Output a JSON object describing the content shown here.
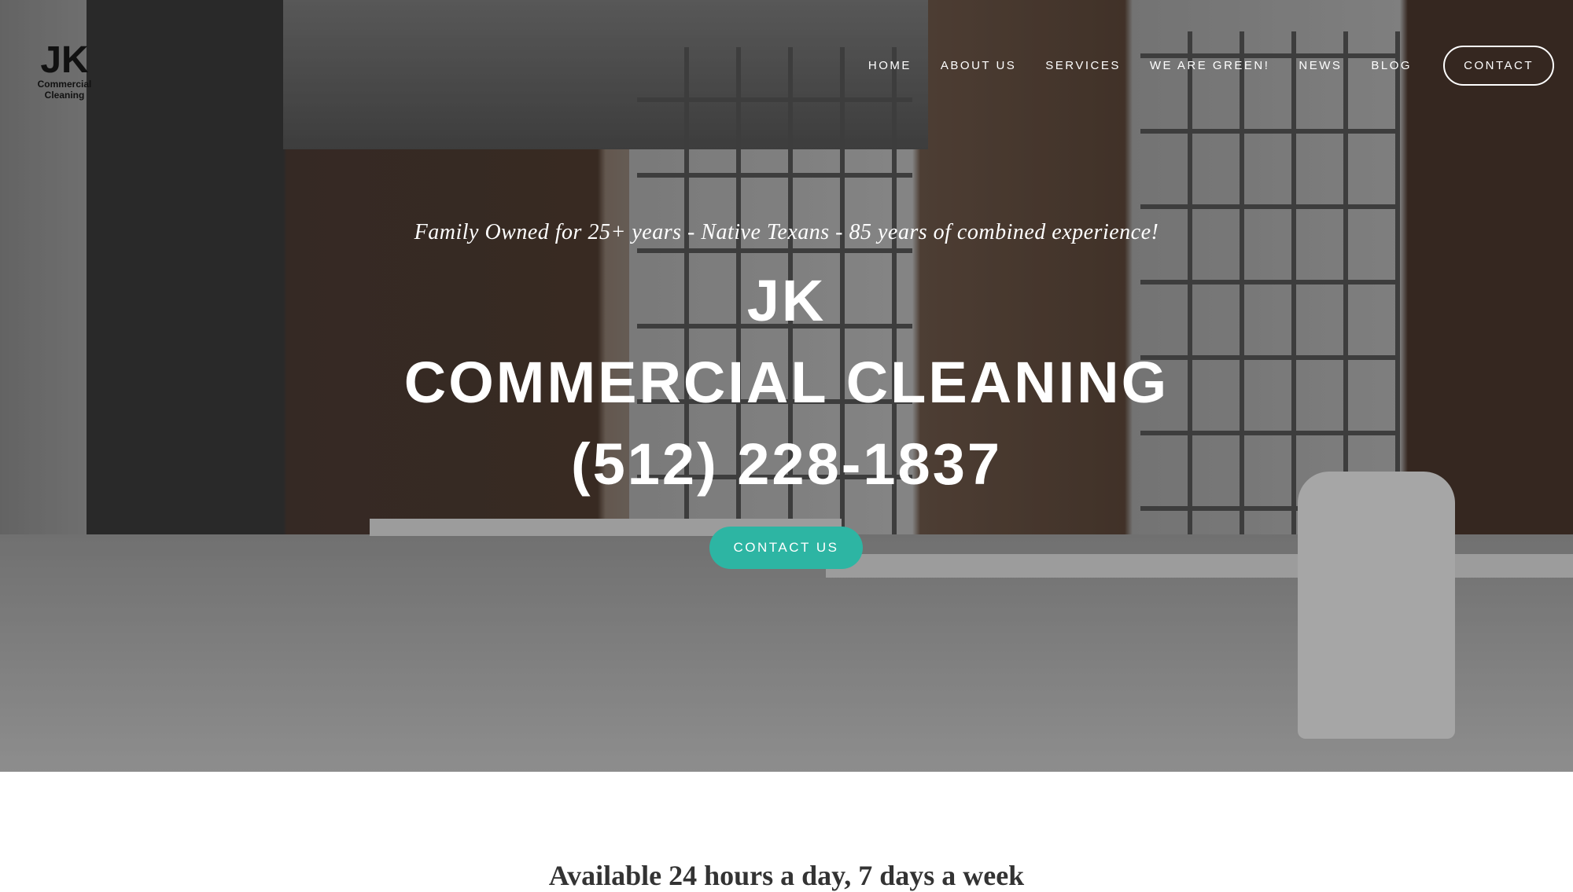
{
  "logo": {
    "title": "JK",
    "subtitle": "Commercial Cleaning"
  },
  "nav": {
    "items": [
      "HOME",
      "ABOUT US",
      "SERVICES",
      "WE ARE GREEN!",
      "NEWS",
      "BLOG"
    ],
    "contact": "CONTACT"
  },
  "hero": {
    "tagline": "Family Owned for 25+ years - Native Texans - 85 years of combined experience!",
    "line1": "JK",
    "line2": "COMMERCIAL CLEANING",
    "phone": "(512) 228-1837",
    "button": "CONTACT US"
  },
  "section": {
    "heading": "Available 24 hours a day, 7 days a week"
  },
  "colors": {
    "accent": "#2db5a3"
  }
}
